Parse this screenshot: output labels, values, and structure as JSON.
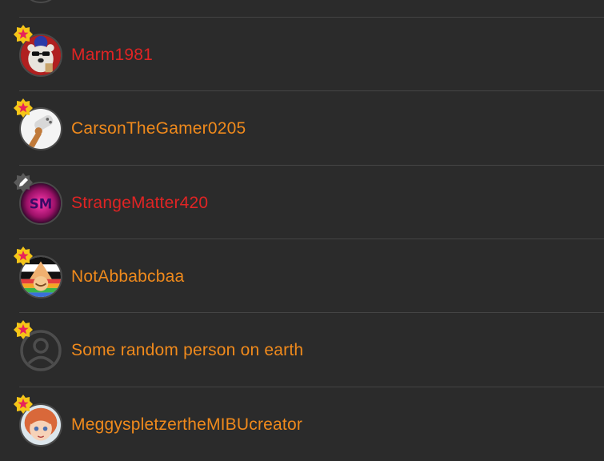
{
  "colors": {
    "background": "#2b2b2b",
    "divider": "#444444",
    "name_red": "#e02424",
    "name_orange": "#f08a1c",
    "badge_yellow": "#f5c518",
    "badge_star": "#e8215a",
    "badge_gray": "#5a5a5a"
  },
  "users": [
    {
      "name": "Marm1981",
      "name_color": "#e02424",
      "badge": "star-badge-icon",
      "avatar": "polar-bear-avatar"
    },
    {
      "name": "CarsonTheGamer0205",
      "name_color": "#f08a1c",
      "badge": "star-badge-icon",
      "avatar": "game-controller-avatar"
    },
    {
      "name": "StrangeMatter420",
      "name_color": "#e02424",
      "badge": "pencil-badge-icon",
      "avatar": "sm-logo-avatar"
    },
    {
      "name": "NotAbbabcbaa",
      "name_color": "#f08a1c",
      "badge": "star-badge-icon",
      "avatar": "flag-character-avatar"
    },
    {
      "name": "Some random person on earth",
      "name_color": "#f08a1c",
      "badge": "star-badge-icon",
      "avatar": "default-user-avatar"
    },
    {
      "name": "MeggyspletzertheMIBUcreator",
      "name_color": "#f08a1c",
      "badge": "star-badge-icon",
      "avatar": "girl-character-avatar"
    }
  ]
}
